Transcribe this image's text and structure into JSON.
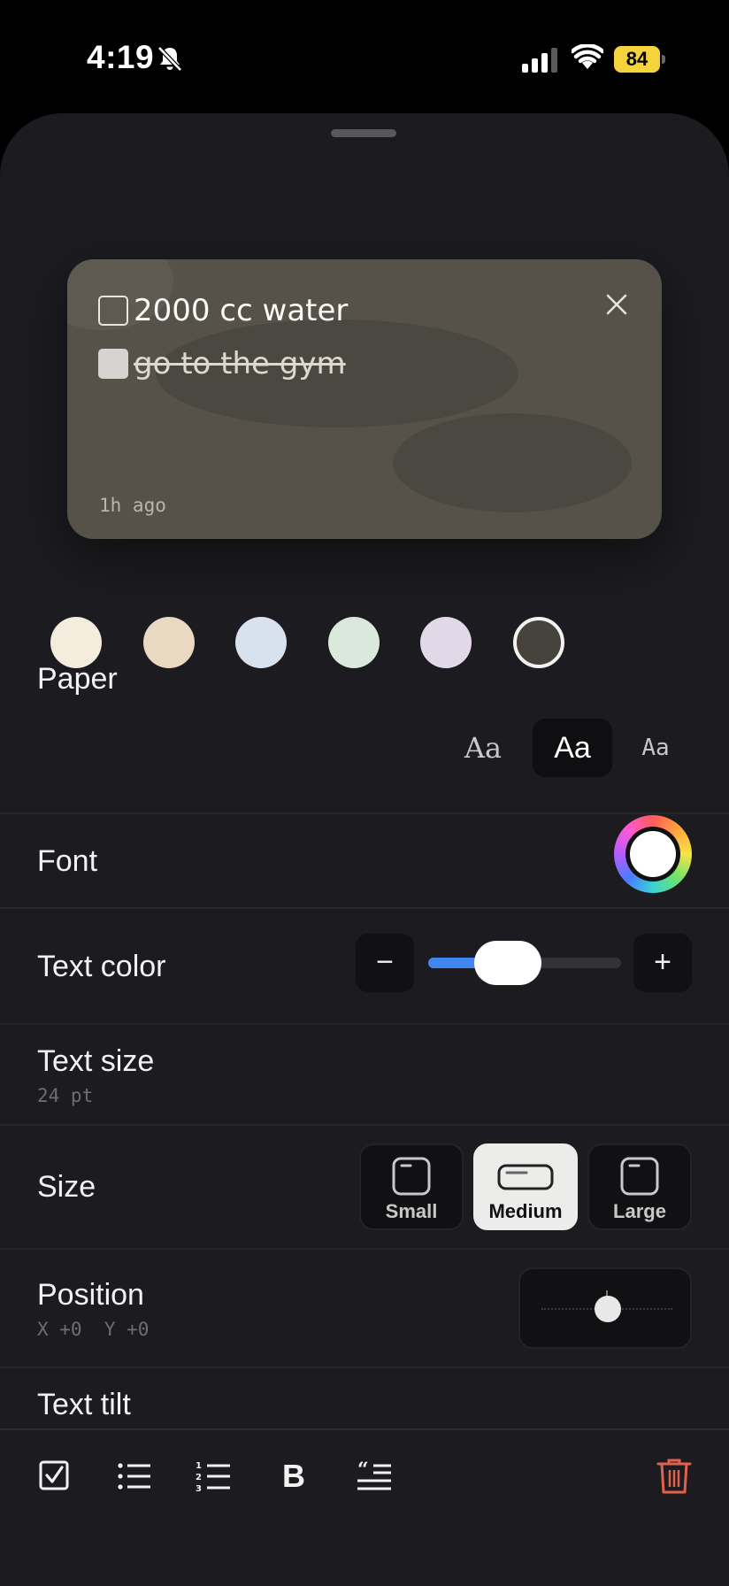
{
  "status_bar": {
    "time": "4:19",
    "battery": "84",
    "icons": [
      "bell-slash-icon",
      "signal-icon",
      "wifi-icon",
      "battery-icon"
    ]
  },
  "note": {
    "items": [
      {
        "text": "2000 cc water",
        "checked": false
      },
      {
        "text": "go to the gym",
        "checked": true
      }
    ],
    "timestamp": "1h ago",
    "background_color": "#56524a"
  },
  "paper": {
    "label": "Paper",
    "swatches": [
      {
        "color": "#f4ecdd",
        "selected": false
      },
      {
        "color": "#e9d9c2",
        "selected": false
      },
      {
        "color": "#d8e1ee",
        "selected": false
      },
      {
        "color": "#dbe8dc",
        "selected": false
      },
      {
        "color": "#e2d9e8",
        "selected": false
      },
      {
        "color": "#46433d",
        "selected": true
      }
    ]
  },
  "font": {
    "label": "Font",
    "options": [
      {
        "label": "Aa",
        "style": "serif",
        "active": false
      },
      {
        "label": "Aa",
        "style": "sans",
        "active": true
      },
      {
        "label": "Aa",
        "style": "mono",
        "active": false
      }
    ]
  },
  "text_color": {
    "label": "Text color",
    "current": "#ffffff"
  },
  "text_size": {
    "label": "Text size",
    "value_label": "24 pt",
    "minus": "−",
    "plus": "+",
    "slider_fraction": 0.3,
    "accent": "#3f86f0"
  },
  "size": {
    "label": "Size",
    "options": [
      {
        "label": "Small",
        "active": false
      },
      {
        "label": "Medium",
        "active": true
      },
      {
        "label": "Large",
        "active": false
      }
    ]
  },
  "position": {
    "label": "Position",
    "value_label": "X +0  Y +0"
  },
  "text_tilt": {
    "label": "Text tilt"
  },
  "toolbar": {
    "tools": [
      "checkbox-icon",
      "bullet-list-icon",
      "numbered-list-icon",
      "bold-icon",
      "quote-icon"
    ],
    "bold_label": "B",
    "delete": "trash-icon",
    "delete_color": "#e2604e"
  }
}
